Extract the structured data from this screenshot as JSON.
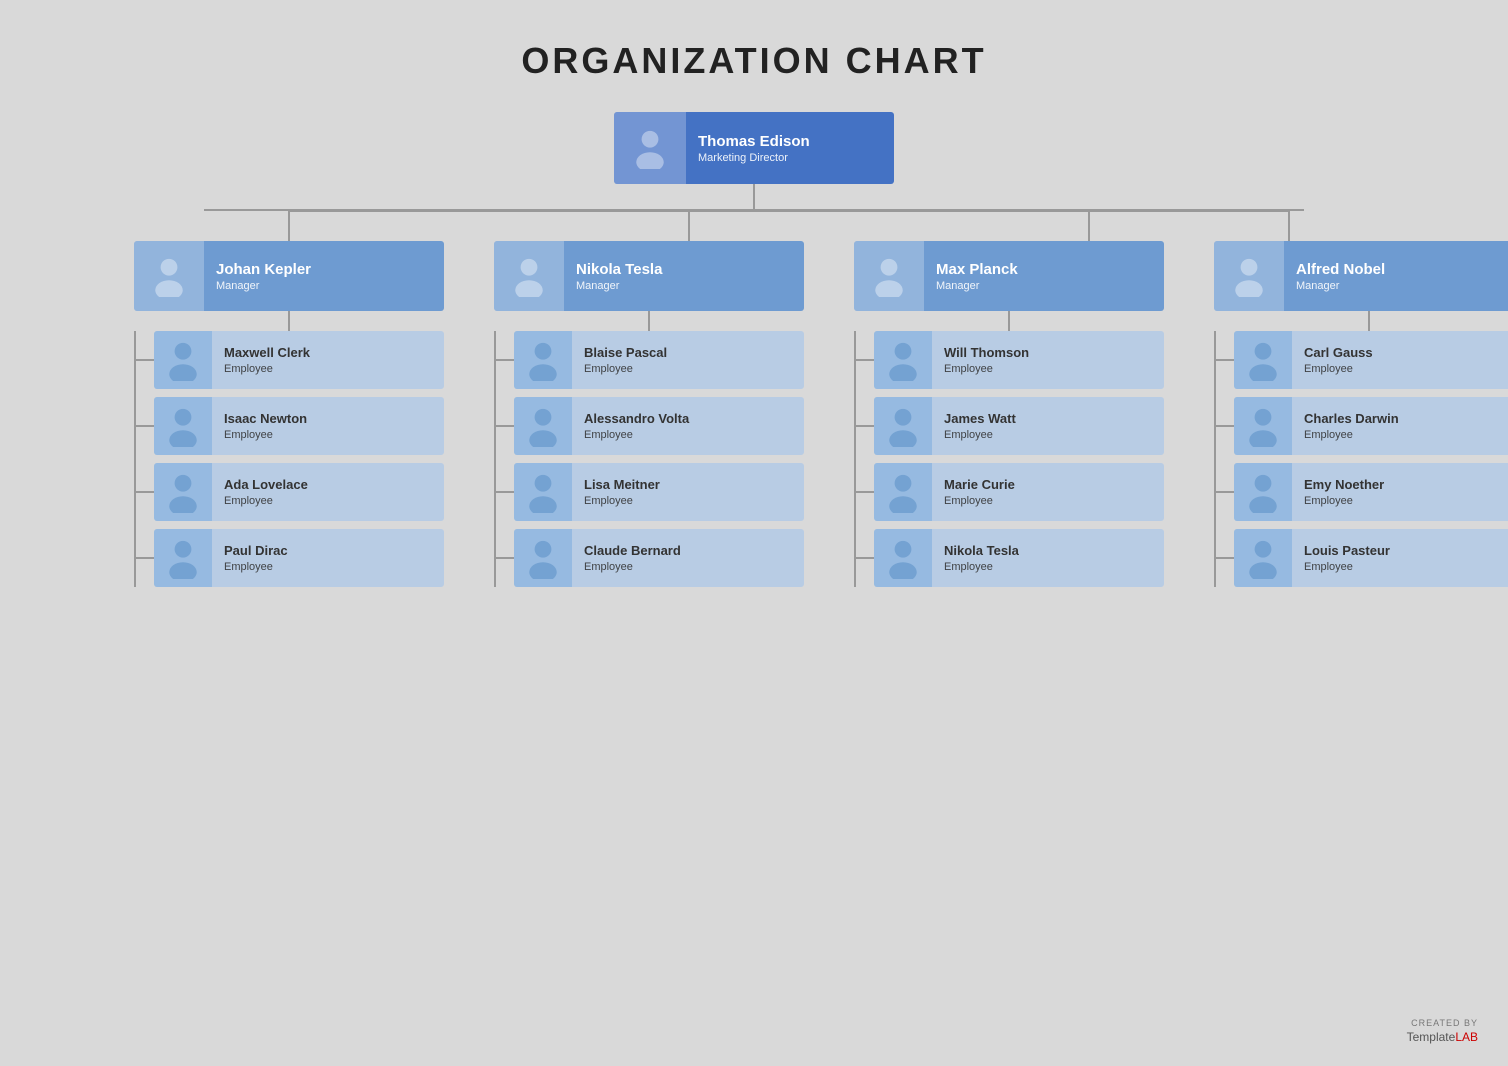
{
  "title": "ORGANIZATION CHART",
  "director": {
    "name": "Thomas Edison",
    "role": "Marketing Director"
  },
  "managers": [
    {
      "name": "Johan Kepler",
      "role": "Manager"
    },
    {
      "name": "Nikola Tesla",
      "role": "Manager"
    },
    {
      "name": "Max Planck",
      "role": "Manager"
    },
    {
      "name": "Alfred Nobel",
      "role": "Manager"
    }
  ],
  "employees": [
    [
      {
        "name": "Maxwell Clerk",
        "role": "Employee"
      },
      {
        "name": "Isaac Newton",
        "role": "Employee"
      },
      {
        "name": "Ada Lovelace",
        "role": "Employee"
      },
      {
        "name": "Paul Dirac",
        "role": "Employee"
      }
    ],
    [
      {
        "name": "Blaise Pascal",
        "role": "Employee"
      },
      {
        "name": "Alessandro Volta",
        "role": "Employee"
      },
      {
        "name": "Lisa Meitner",
        "role": "Employee"
      },
      {
        "name": "Claude Bernard",
        "role": "Employee"
      }
    ],
    [
      {
        "name": "Will Thomson",
        "role": "Employee"
      },
      {
        "name": "James Watt",
        "role": "Employee"
      },
      {
        "name": "Marie Curie",
        "role": "Employee"
      },
      {
        "name": "Nikola Tesla",
        "role": "Employee"
      }
    ],
    [
      {
        "name": "Carl Gauss",
        "role": "Employee"
      },
      {
        "name": "Charles Darwin",
        "role": "Employee"
      },
      {
        "name": "Emy Noether",
        "role": "Employee"
      },
      {
        "name": "Louis Pasteur",
        "role": "Employee"
      }
    ]
  ],
  "branding": {
    "created_by": "CREATED BY",
    "template": "Template",
    "lab": "LAB"
  },
  "colors": {
    "dark_card": "#3d6fba",
    "medium_card": "#5d8ec4",
    "light_card": "#aec8e8",
    "line": "#999999",
    "background": "#d9d9d9"
  }
}
